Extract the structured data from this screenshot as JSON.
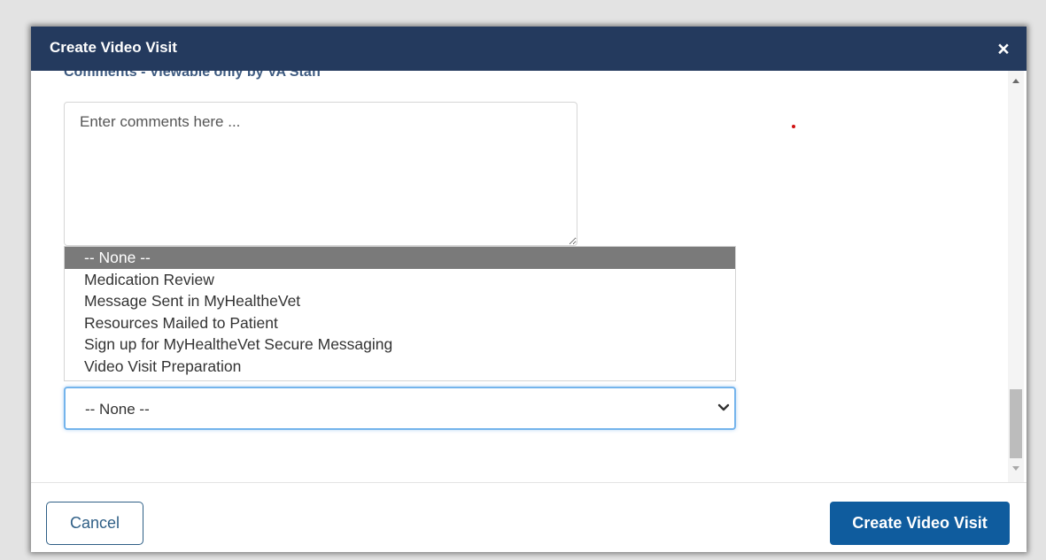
{
  "dialog": {
    "title": "Create Video Visit",
    "close_label": "×"
  },
  "comments": {
    "label": "Comments - Viewable only by VA Staff",
    "placeholder": "Enter comments here ...",
    "value": ""
  },
  "template_select": {
    "selected_value": "-- None --",
    "options": [
      "-- None --",
      "Medication Review",
      "Message Sent in MyHealtheVet",
      "Resources Mailed to Patient",
      "Sign up for MyHealtheVet Secure Messaging",
      "Video Visit Preparation"
    ]
  },
  "footer": {
    "cancel_label": "Cancel",
    "create_label": "Create Video Visit"
  },
  "colors": {
    "header_bg": "#243a5e",
    "primary_button": "#0f5c9e",
    "selected_option_bg": "#7a7a7a",
    "focus_border": "#74b4ec"
  }
}
